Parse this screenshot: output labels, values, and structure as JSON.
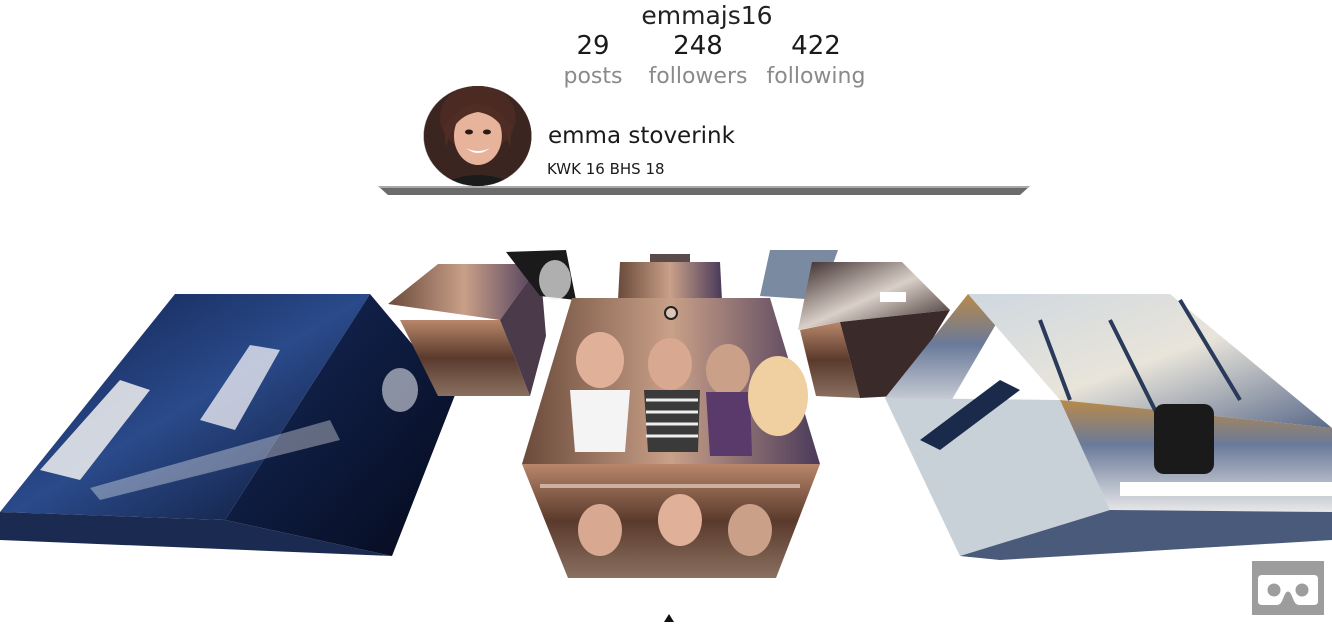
{
  "profile": {
    "username": "emmajs16",
    "full_name": "emma stoverink",
    "bio": "KWK 16  BHS 18",
    "stats": [
      {
        "value": "29",
        "label": "posts"
      },
      {
        "value": "248",
        "label": "followers"
      },
      {
        "value": "422",
        "label": "following"
      }
    ]
  },
  "colors": {
    "stat_label": "#8a8a8a",
    "vr_button": "#9d9d9d",
    "profile_bar": "#6b6b6b"
  },
  "icons": {
    "vr": "cardboard-headset-icon",
    "floor": "triangle-up-icon",
    "cursor": "reticle-icon"
  }
}
